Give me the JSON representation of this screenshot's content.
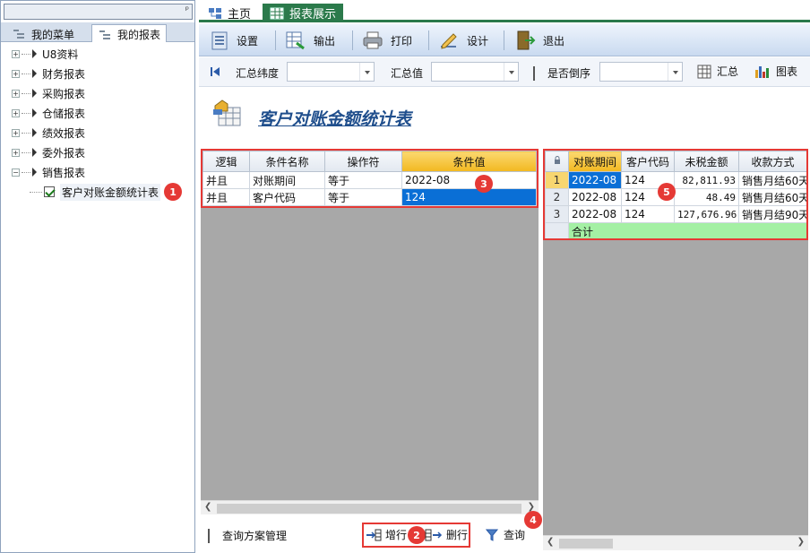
{
  "left_panel": {
    "pin_label": "ᵖ",
    "tabs": [
      {
        "label": "我的菜单"
      },
      {
        "label": "我的报表"
      }
    ],
    "tree": [
      {
        "label": "U8资料",
        "expander": "+"
      },
      {
        "label": "财务报表",
        "expander": "+"
      },
      {
        "label": "采购报表",
        "expander": "+"
      },
      {
        "label": "仓储报表",
        "expander": "+"
      },
      {
        "label": "绩效报表",
        "expander": "+"
      },
      {
        "label": "委外报表",
        "expander": "+"
      },
      {
        "label": "销售报表",
        "expander": "−"
      }
    ],
    "selected_report": "客户对账金额统计表",
    "badge1": "1"
  },
  "tabs": {
    "home": "主页",
    "report_view": "报表展示"
  },
  "toolbar": {
    "settings": "设置",
    "export": "输出",
    "print": "打印",
    "design": "设计",
    "exit": "退出"
  },
  "filter": {
    "summary_dim_label": "汇总纬度",
    "summary_dim_value": "",
    "summary_val_label": "汇总值",
    "summary_val_value": "",
    "reverse_label": "是否倒序",
    "reverse_value": "",
    "summarize_btn": "汇总",
    "chart_btn": "图表"
  },
  "report_title": "客户对账金额统计表",
  "conditions": {
    "headers": [
      "逻辑",
      "条件名称",
      "操作符",
      "条件值"
    ],
    "rows": [
      {
        "logic": "并且",
        "name": "对账期间",
        "op": "等于",
        "value": "2022-08"
      },
      {
        "logic": "并且",
        "name": "客户代码",
        "op": "等于",
        "value": "124"
      }
    ],
    "badge3": "3"
  },
  "bottom": {
    "scheme_label": "查询方案管理",
    "add_row": "增行",
    "del_row": "删行",
    "query": "查询",
    "badge2": "2",
    "badge4": "4"
  },
  "results": {
    "headers": [
      "对账期间",
      "客户代码",
      "未税金额",
      "收款方式"
    ],
    "rows": [
      {
        "no": "1",
        "period": "2022-08",
        "customer": "124",
        "amount": "82,811.93",
        "method": "销售月结60天"
      },
      {
        "no": "2",
        "period": "2022-08",
        "customer": "124",
        "amount": "48.49",
        "method": "销售月结60天"
      },
      {
        "no": "3",
        "period": "2022-08",
        "customer": "124",
        "amount": "127,676.96",
        "method": "销售月结90天"
      }
    ],
    "total_label": "合计",
    "badge5": "5"
  },
  "colors": {
    "accent_green": "#2b7a4b",
    "title_blue": "#1f4e8c",
    "selection_blue": "#0a6fd6",
    "header_orange": "#f7c840",
    "total_green": "#a4f0a4",
    "badge_red": "#e53935"
  }
}
